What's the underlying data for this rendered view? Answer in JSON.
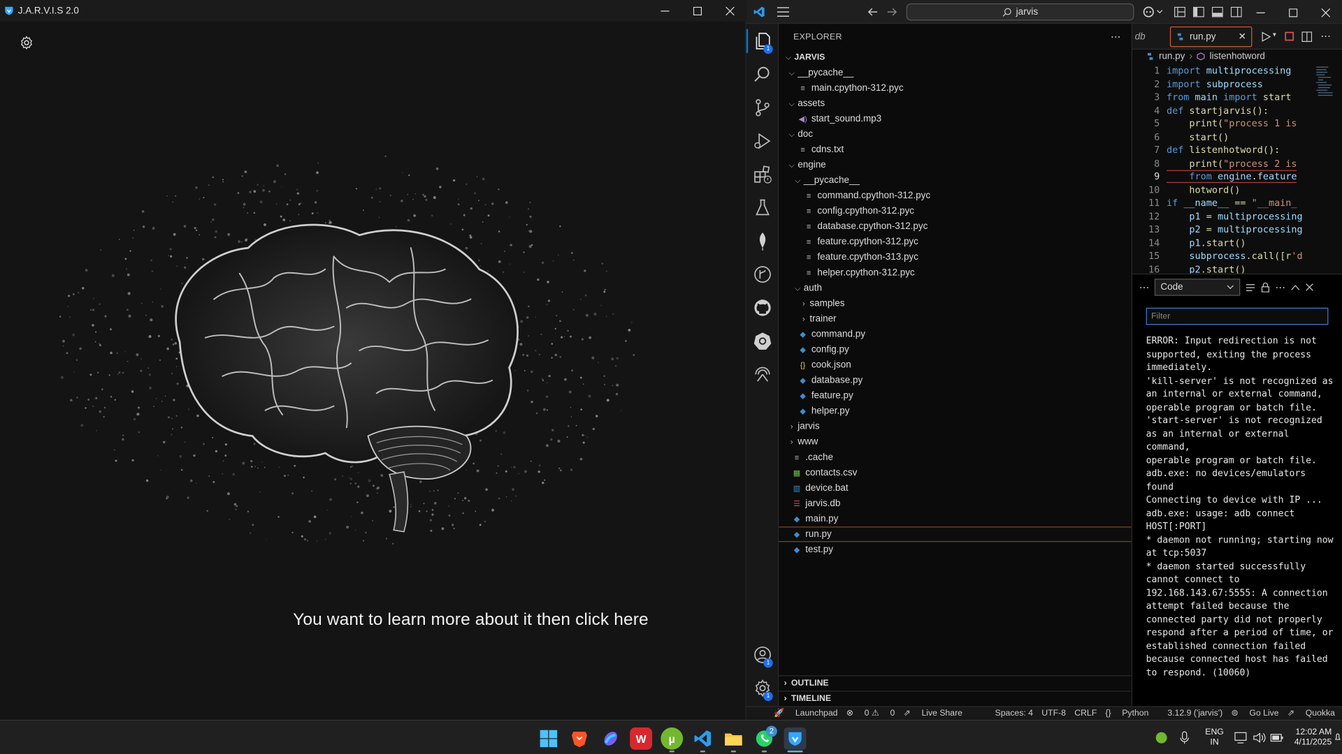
{
  "jarvis": {
    "title": "J.A.R.V.I.S 2.0",
    "cta": "You want to learn more about it then click here",
    "icons": [
      "settings-icon",
      "brain-image"
    ]
  },
  "vscode": {
    "search": "jarvis",
    "explorer_label": "EXPLORER",
    "tree": [
      {
        "label": "JARVIS",
        "depth": 0,
        "kind": "root",
        "open": true
      },
      {
        "label": "__pycache__",
        "depth": 1,
        "kind": "folder",
        "open": true
      },
      {
        "label": "main.cpython-312.pyc",
        "depth": 2,
        "kind": "pyc"
      },
      {
        "label": "assets",
        "depth": 1,
        "kind": "folder",
        "open": true
      },
      {
        "label": "start_sound.mp3",
        "depth": 2,
        "kind": "audio"
      },
      {
        "label": "doc",
        "depth": 1,
        "kind": "folder",
        "open": true
      },
      {
        "label": "cdns.txt",
        "depth": 2,
        "kind": "text"
      },
      {
        "label": "engine",
        "depth": 1,
        "kind": "folder",
        "open": true
      },
      {
        "label": "__pycache__",
        "depth": 2,
        "kind": "folder",
        "open": true
      },
      {
        "label": "command.cpython-312.pyc",
        "depth": 3,
        "kind": "pyc"
      },
      {
        "label": "config.cpython-312.pyc",
        "depth": 3,
        "kind": "pyc"
      },
      {
        "label": "database.cpython-312.pyc",
        "depth": 3,
        "kind": "pyc"
      },
      {
        "label": "feature.cpython-312.pyc",
        "depth": 3,
        "kind": "pyc"
      },
      {
        "label": "feature.cpython-313.pyc",
        "depth": 3,
        "kind": "pyc"
      },
      {
        "label": "helper.cpython-312.pyc",
        "depth": 3,
        "kind": "pyc"
      },
      {
        "label": "auth",
        "depth": 2,
        "kind": "folder",
        "open": true
      },
      {
        "label": "samples",
        "depth": 3,
        "kind": "folder",
        "open": false
      },
      {
        "label": "trainer",
        "depth": 3,
        "kind": "folder",
        "open": false
      },
      {
        "label": "command.py",
        "depth": 2,
        "kind": "python"
      },
      {
        "label": "config.py",
        "depth": 2,
        "kind": "python"
      },
      {
        "label": "cook.json",
        "depth": 2,
        "kind": "json"
      },
      {
        "label": "database.py",
        "depth": 2,
        "kind": "python"
      },
      {
        "label": "feature.py",
        "depth": 2,
        "kind": "python"
      },
      {
        "label": "helper.py",
        "depth": 2,
        "kind": "python"
      },
      {
        "label": "jarvis",
        "depth": 1,
        "kind": "folder",
        "open": false
      },
      {
        "label": "www",
        "depth": 1,
        "kind": "folder",
        "open": false
      },
      {
        "label": ".cache",
        "depth": 1,
        "kind": "text"
      },
      {
        "label": "contacts.csv",
        "depth": 1,
        "kind": "csv"
      },
      {
        "label": "device.bat",
        "depth": 1,
        "kind": "bat"
      },
      {
        "label": "jarvis.db",
        "depth": 1,
        "kind": "db"
      },
      {
        "label": "main.py",
        "depth": 1,
        "kind": "python"
      },
      {
        "label": "run.py",
        "depth": 1,
        "kind": "python",
        "selected": true
      },
      {
        "label": "test.py",
        "depth": 1,
        "kind": "python"
      }
    ],
    "outline_label": "OUTLINE",
    "timeline_label": "TIMELINE",
    "tabs": {
      "previous": "db",
      "active": "run.py"
    },
    "breadcrumb": {
      "file": "run.py",
      "symbol": "listenhotword"
    },
    "code": [
      {
        "n": "1",
        "text": "import multiprocessing"
      },
      {
        "n": "2",
        "text": "import subprocess"
      },
      {
        "n": "3",
        "text": "from main import start"
      },
      {
        "n": "4",
        "text": "def startjarvis():"
      },
      {
        "n": "5",
        "text": "    print(\"process 1 is"
      },
      {
        "n": "6",
        "text": "    start()"
      },
      {
        "n": "7",
        "text": "def listenhotword():"
      },
      {
        "n": "8",
        "text": "    print(\"process 2 is"
      },
      {
        "n": "9",
        "text": "    from engine.feature",
        "highlight": true
      },
      {
        "n": "10",
        "text": "    hotword()"
      },
      {
        "n": "11",
        "text": "if __name__ == \"__main_"
      },
      {
        "n": "12",
        "text": "    p1 = multiprocessing"
      },
      {
        "n": "13",
        "text": "    p2 = multiprocessing"
      },
      {
        "n": "14",
        "text": "    p1.start()"
      },
      {
        "n": "15",
        "text": "    subprocess.call([r'd"
      },
      {
        "n": "16",
        "text": "    p2.start()"
      }
    ],
    "panel": {
      "channel": "Code",
      "filter_placeholder": "Filter",
      "output": [
        "ERROR: Input redirection is not supported, exiting the process immediately.",
        "'kill-server' is not recognized as an internal or external command,",
        "operable program or batch file.",
        "'start-server' is not recognized as an internal or external command,",
        "operable program or batch file.",
        "adb.exe: no devices/emulators found",
        "Connecting to device with IP ...",
        "adb.exe: usage: adb connect HOST[:PORT]",
        "* daemon not running; starting now at tcp:5037",
        "* daemon started successfully",
        "cannot connect to 192.168.143.67:5555: A connection attempt failed because the connected party did not properly respond after a period of time, or established connection failed because connected host has failed to respond. (10060)"
      ]
    },
    "status": {
      "launchpad": "Launchpad",
      "errors": "0",
      "warnings": "0",
      "live_share": "Live Share",
      "spaces": "Spaces: 4",
      "encoding": "UTF-8",
      "eol": "CRLF",
      "language": "Python",
      "interpreter": "3.12.9 ('jarvis')",
      "go_live": "Go Live",
      "quokka": "Quokka"
    },
    "badges": {
      "explorer": "1",
      "accounts": "1",
      "manage": "1"
    }
  },
  "taskbar": {
    "apps": [
      "start",
      "brave",
      "copilot",
      "wps-office",
      "utorrent",
      "vscode",
      "file-explorer",
      "whatsapp",
      "jarvis"
    ],
    "whatsapp_badge": "2",
    "lang_line1": "ENG",
    "lang_line2": "IN",
    "time": "12:02 AM",
    "date": "4/11/2025"
  },
  "colors": {
    "vscode_accent": "#0078d4",
    "selection_border": "#d85c2c",
    "jarvis_bg": "#141414",
    "taskbar_bg": "#202020"
  }
}
